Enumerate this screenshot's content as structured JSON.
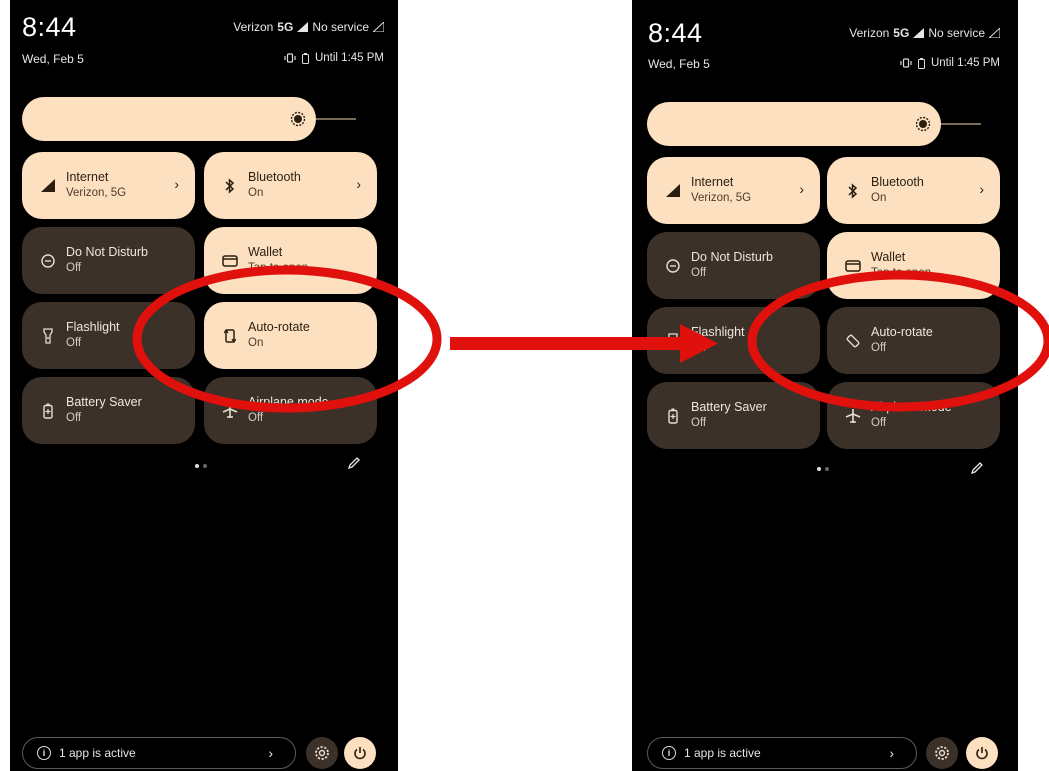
{
  "left": {
    "time": "8:44",
    "date": "Wed, Feb 5",
    "carrier": "Verizon",
    "network": "5G",
    "service": "No service",
    "alarm": "Until 1:45 PM",
    "tiles": {
      "internet": {
        "title": "Internet",
        "sub": "Verizon, 5G"
      },
      "bluetooth": {
        "title": "Bluetooth",
        "sub": "On"
      },
      "dnd": {
        "title": "Do Not Disturb",
        "sub": "Off"
      },
      "wallet": {
        "title": "Wallet",
        "sub": "Tap to open"
      },
      "flashlight": {
        "title": "Flashlight",
        "sub": "Off"
      },
      "autorotate": {
        "title": "Auto-rotate",
        "sub": "On"
      },
      "battery": {
        "title": "Battery Saver",
        "sub": "Off"
      },
      "airplane": {
        "title": "Airplane mode",
        "sub": "Off"
      }
    },
    "footer": {
      "active": "1 app is active"
    }
  },
  "right": {
    "time": "8:44",
    "date": "Wed, Feb 5",
    "carrier": "Verizon",
    "network": "5G",
    "service": "No service",
    "alarm": "Until 1:45 PM",
    "tiles": {
      "internet": {
        "title": "Internet",
        "sub": "Verizon, 5G"
      },
      "bluetooth": {
        "title": "Bluetooth",
        "sub": "On"
      },
      "dnd": {
        "title": "Do Not Disturb",
        "sub": "Off"
      },
      "wallet": {
        "title": "Wallet",
        "sub": "Tap to open"
      },
      "flashlight": {
        "title": "Flashlight",
        "sub": "Off"
      },
      "autorotate": {
        "title": "Auto-rotate",
        "sub": "Off"
      },
      "battery": {
        "title": "Battery Saver",
        "sub": "Off"
      },
      "airplane": {
        "title": "Airplane mode",
        "sub": "Off"
      }
    },
    "footer": {
      "active": "1 app is active"
    }
  },
  "colors": {
    "tile_on": "#fce0bf",
    "tile_off": "#3b3128",
    "annotation": "#e0100c"
  }
}
